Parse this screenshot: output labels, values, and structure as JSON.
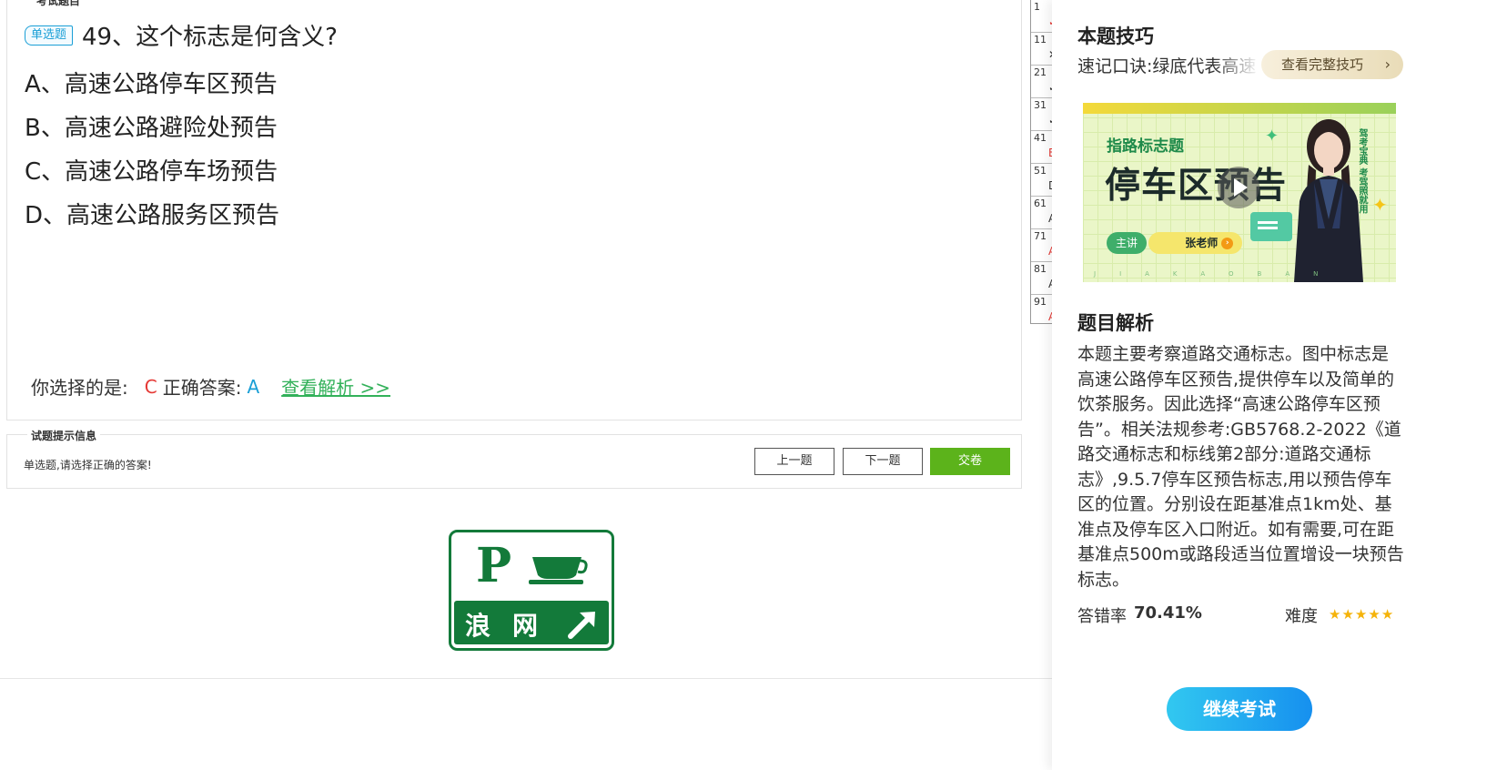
{
  "question_panel": {
    "legend": "考试题目",
    "type_badge": "单选题",
    "title": "49、这个标志是何含义?",
    "options": [
      "A、高速公路停车区预告",
      "B、高速公路避险处预告",
      "C、高速公路停车场预告",
      "D、高速公路服务区预告"
    ],
    "answer": {
      "your_choice_label": "你选择的是:",
      "your_choice": "C",
      "correct_label": "正确答案:",
      "correct": "A",
      "view_analysis": "查看解析 >>"
    }
  },
  "number_grid": [
    {
      "n": "1",
      "mark": "✓",
      "color": "#e53935"
    },
    {
      "n": "11",
      "mark": "✕",
      "color": "#333333"
    },
    {
      "n": "21",
      "mark": "✓",
      "color": "#333333"
    },
    {
      "n": "31",
      "mark": "✓",
      "color": "#333333"
    },
    {
      "n": "41",
      "mark": "B",
      "color": "#e53935"
    },
    {
      "n": "51",
      "mark": "D",
      "color": "#333333"
    },
    {
      "n": "61",
      "mark": "A",
      "color": "#333333"
    },
    {
      "n": "71",
      "mark": "A",
      "color": "#e53935"
    },
    {
      "n": "81",
      "mark": "A",
      "color": "#333333"
    },
    {
      "n": "91",
      "mark": "A",
      "color": "#e53935"
    }
  ],
  "hint_panel": {
    "legend": "试题提示信息",
    "text": "单选题,请选择正确的答案!",
    "prev": "上一题",
    "next": "下一题",
    "submit": "交卷"
  },
  "sign": {
    "p": "P",
    "line1": "浪",
    "line2": "网",
    "color": "#137a3a"
  },
  "sidebar": {
    "tip_title": "本题技巧",
    "tip_line": "速记口诀:绿底代表高速",
    "tip_button": "查看完整技巧",
    "video": {
      "subtitle": "指路标志题",
      "main": "停车区预告",
      "lecturer_label": "主讲",
      "teacher": "张老师",
      "side_text": "驾考宝典 考驾照就用",
      "letters": "JIAKAOBAN"
    },
    "analysis_title": "题目解析",
    "analysis_text": "本题主要考察道路交通标志。图中标志是高速公路停车区预告,提供停车以及简单的饮茶服务。因此选择“高速公路停车区预告”。相关法规参考:GB5768.2-2022《道路交通标志和标线第2部分:道路交通标志》,9.5.7停车区预告标志,用以预告停车区的位置。分别设在距基准点1km处、基准点及停车区入口附近。如有需要,可在距基准点500m或路段适当位置增设一块预告标志。",
    "error_rate_label": "答错率",
    "error_rate": "70.41%",
    "difficulty_label": "难度",
    "difficulty_stars": 5,
    "continue": "继续考试"
  }
}
